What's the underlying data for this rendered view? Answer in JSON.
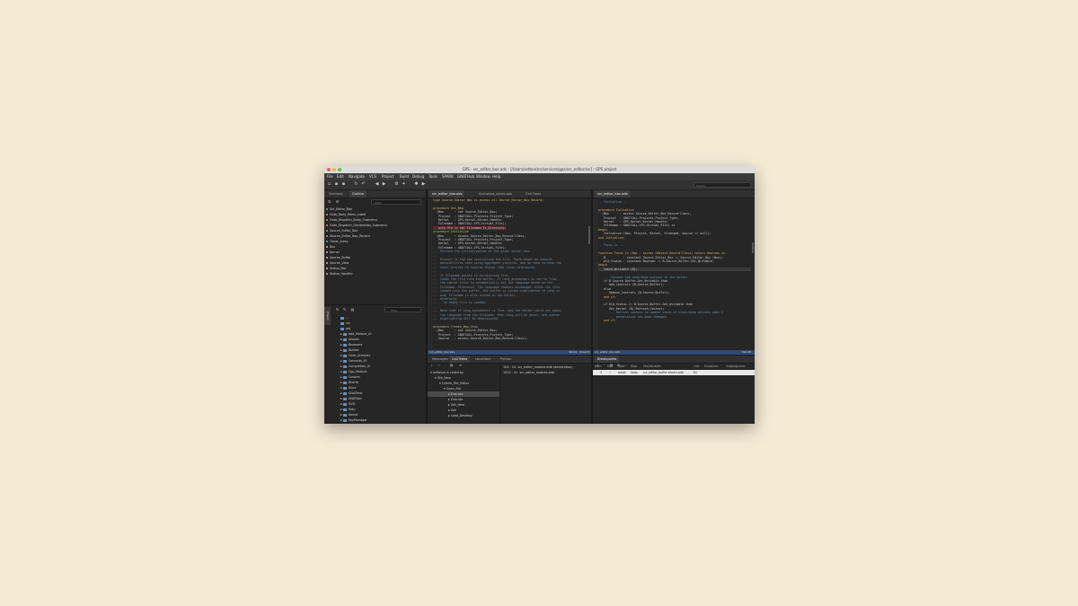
{
  "window": {
    "title": "GPS - src_editor_box.ads - [/Users/setton/src/services/gps/src_editor/src] - GPS project"
  },
  "menubar": [
    "File",
    "Edit",
    "Navigate",
    "VCS",
    "Project",
    "Build",
    "Debug",
    "Tools",
    "SPARK",
    "GNATHub",
    "Window",
    "Help"
  ],
  "search": {
    "placeholder": "Search"
  },
  "left": {
    "tabs": [
      "Scenario",
      "Outline"
    ],
    "filter_placeholder": "Filter",
    "outline": [
      "Src_Editor_Box",
      "Goto_Body_Menu_Label",
      "Goto_Dispatch_Body_Submenu",
      "Goto_Dispatch_Declaration_Submenu",
      "Source_Editor_Box",
      "Source_Editor_Box_Record",
      "Timer_Array",
      "Box",
      "Kernel",
      "Source_Buffer",
      "Source_View",
      "Status_Bar",
      "Status_Handler"
    ],
    "project_label": "Project",
    "project_filter_placeholder": "Filter",
    "tree": [
      "...",
      "src",
      "obj",
      "Ada_Module_UI",
      "Aliases",
      "Browsers",
      "Builder",
      "Code_Analysis",
      "Commits_UI",
      "Completion_UI",
      "Cpp_Module",
      "Custom",
      "Distrib",
      "Docs",
      "GNATtest",
      "GNATdoc",
      "GVD",
      "Help",
      "Kernel",
      "KeyManager",
      "Navigation"
    ]
  },
  "editor": {
    "tabs": [
      "src_editor_box.ads",
      "Scenarios_views.ads",
      "Call Trees"
    ],
    "lines": [
      "type Source_Editor_Box is access all Source_Editor_Box_Record;",
      "",
      "procedure Gtk_New",
      "  (Box      : out Source_Editor_Box;",
      "   Project  : GNATCOLL.Projects.Project_Type;",
      "   Kernel   : GPS.Kernel.Kernel_Handle;",
      "   Filename : GNATCOLL.VFS.Virtual_File);",
      "   with Pre => not Filename.Is_Directory;",
      "procedure Initialize",
      "  (Box      : access Source_Editor_Box_Record'Class;",
      "   Project  : GNATCOLL.Projects.Project_Type;",
      "   Kernel   : GPS.Kernel.Kernel_Handle;",
      "   Filename : GNATCOLL.VFS.Virtual_File);",
      "--  Perform the initialization of the given editor box.",
      "--",
      "--  Project is the one controlling the file. There might be several",
      "--  possibilities when using aggregate projects, and we need to know the",
      "--  exact project to resolve things like cross-references.",
      "--",
      "--  If Filename points to an existing file,",
      "--  loads the file into the buffer. If Lang_Autodetect is set to True,",
      "--  the editor tries to automatically set the language based on the",
      "--  Filename. Otherwise, the language remains unchanged. After the file",
      "--  loaded into the buffer, the buffer is syntax-highlighted if Lang is",
      "--  and, Filename is also stored in the Editor.",
      "--  Otherwise:",
      "--    an empty file is loaded.",
      "--",
      "--  Note that if Lang_Autodetect is True, and the editor could not guess",
      "--  the language from the filename, then Lang will be unset, and syntax",
      "--  highlighting will be deactivated.",
      "",
      "procedure Create_New_View",
      "  (Box      : out Source_Editor_Box;",
      "   Project  : GNATCOLL.Projects.Project_Type;",
      "   Source   : access Source_Editor_Box_Record'Class);"
    ],
    "status_left": "src_editor_box.ads",
    "status_right": "96:44",
    "status_mode": "[Insert]"
  },
  "right": {
    "tabs": [
      "src_editor_box.adb"
    ],
    "lines": [
      "-- Initialize --",
      "",
      "procedure Initialize",
      "  (Box      : access Source_Editor_Box_Record'Class;",
      "   Project  : GNATCOLL.Projects.Project_Type;",
      "   Kernel   : GPS.Kernel.Kernel_Handle;",
      "   Filename : GNATCOLL.VFS.Virtual_File) is",
      "begin",
      "   Initialize (Box, Project, Kernel, Filename, Source => null);",
      "end Initialize;",
      "",
      "-- Focus_In --",
      "",
      "function Focus_In (Box : access GObject_Record'Class) return Boolean is",
      "   B          : constant Source_Editor_Box := Source_Editor_Box (Box);",
      "   Old_Status : constant Boolean := B.Source_Buffer.Get_Writable;",
      "begin",
      "   Check_Writable (B);",
      "",
      "   --  Connect the Undo/Redo buttons to the buffer",
      "   if B.Source_Buffer.Get_Writable then",
      "      Add_Controls (B.Source_Buffer);",
      "   else",
      "      Remove_Controls (B.Source_Buffer);",
      "   end if;",
      "",
      "   if Old_Status /= B.Source_Buffer.Get_Writable then",
      "      Get_Kernel (B).Refresh_Context;",
      "      --  Refresh context to update state of Lines/Undo actions when f",
      "      --  permissions has been changed.",
      "   end if;"
    ],
    "status_left": "src_editor_box.adb",
    "status_right": "702:28"
  },
  "bottom_left": {
    "tabs": [
      "Messages",
      "Call Trees",
      "Locations",
      "Python"
    ],
    "tree": [
      "Initialize is called by",
      "Gtk_New",
      "Create_File_Editor",
      "Open_File",
      "Execute",
      "Execute",
      "Get_New",
      "Get",
      "Load_Desktop"
    ],
    "table": [
      [
        "104",
        "24",
        "src_editor_module.adb (declaration)"
      ],
      [
        "1502",
        "22",
        "src_editor_module.adb"
      ]
    ]
  },
  "bottom_right": {
    "tabs": [
      "Breakpoints"
    ],
    "headers": [
      "Num",
      "Enb",
      "Type",
      "Disp",
      "File/Variable",
      "Line",
      "Exception",
      "Subprograms"
    ],
    "row": [
      "3",
      "✓",
      "break",
      "keep",
      "src_editor_buffer-blocks.adb",
      "81",
      "",
      ""
    ]
  }
}
